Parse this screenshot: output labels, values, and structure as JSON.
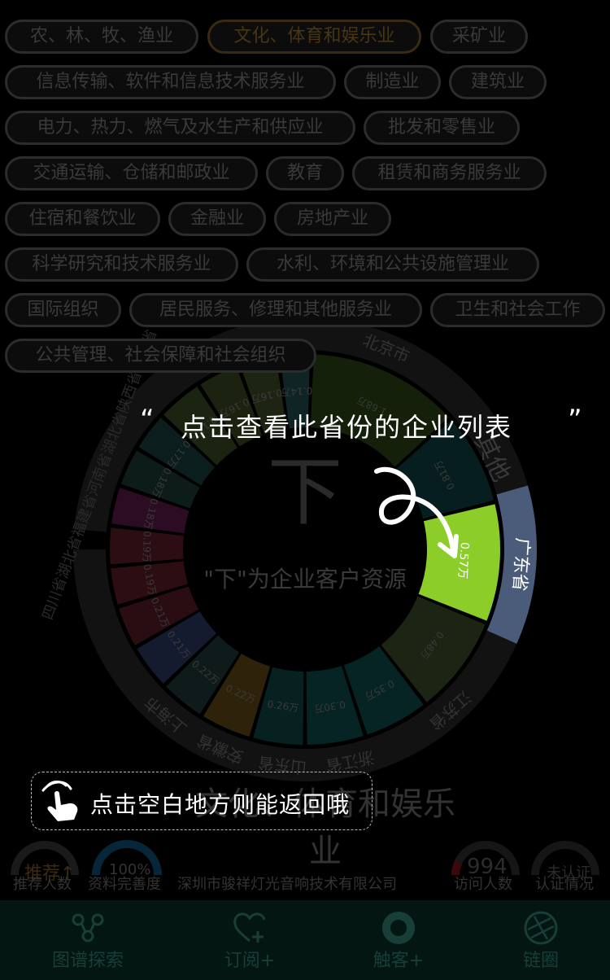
{
  "industries": [
    {
      "label": "农、林、牧、渔业"
    },
    {
      "label": "文化、体育和娱乐业",
      "active": true
    },
    {
      "label": "采矿业"
    },
    {
      "label": "信息传输、软件和信息技术服务业"
    },
    {
      "label": "制造业"
    },
    {
      "label": "建筑业"
    },
    {
      "label": "电力、热力、燃气及水生产和供应业"
    },
    {
      "label": "批发和零售业"
    },
    {
      "label": "交通运输、仓储和邮政业"
    },
    {
      "label": "教育"
    },
    {
      "label": "租赁和商务服务业"
    },
    {
      "label": "住宿和餐饮业"
    },
    {
      "label": "金融业"
    },
    {
      "label": "房地产业"
    },
    {
      "label": "科学研究和技术服务业"
    },
    {
      "label": "水利、环境和公共设施管理业"
    },
    {
      "label": "国际组织"
    },
    {
      "label": "居民服务、修理和其他服务业"
    },
    {
      "label": "卫生和社会工作"
    },
    {
      "label": "公共管理、社会保障和社会组织"
    }
  ],
  "wheel": {
    "center_char": "下",
    "center_desc": "\"下\"为企业客户资源",
    "segments": [
      {
        "value": "0.57万",
        "color": "#8ccd2a",
        "highlight": true
      },
      {
        "value": "0.48万",
        "color": "#1c2414"
      },
      {
        "value": "0.35万",
        "color": "#052423"
      },
      {
        "value": "0.30万",
        "color": "#052423"
      },
      {
        "value": "0.26万",
        "color": "#072020"
      },
      {
        "value": "0.22万",
        "color": "#2e230a"
      },
      {
        "value": "0.22万",
        "color": "#0f1a1a"
      },
      {
        "value": "0.21万",
        "color": "#141b2e"
      },
      {
        "value": "0.21万",
        "color": "#2a0d12"
      },
      {
        "value": "0.19万",
        "color": "#2c0d12"
      },
      {
        "value": "0.19万",
        "color": "#2d0d14"
      },
      {
        "value": "0.18万",
        "color": "#2c0c22"
      },
      {
        "value": "0.18万",
        "color": "#0d1c18"
      },
      {
        "value": "0.17万",
        "color": "#0b1d1d"
      },
      {
        "value": "0.17万",
        "color": "#1a2410"
      },
      {
        "value": "0.16万",
        "color": "#1c2210"
      },
      {
        "value": "0.16万",
        "color": "#1e2412"
      },
      {
        "value": "0.14万",
        "color": "#0f2424"
      },
      {
        "value": "1.68万",
        "color": "#15200b"
      },
      {
        "value": "0.81万",
        "color": "#061e20"
      }
    ],
    "outer_labels": {
      "guangdong": "广东省",
      "beijing": "北京市",
      "other": "其他",
      "jiangsu": "江苏省",
      "zhejiang": "浙江省",
      "shandong": "山东省",
      "anhui": "安徽省",
      "shanghai": "上海市",
      "left_provinces": "四川省湖北省福建省河南省湖北省陕西省河北省"
    }
  },
  "tip": {
    "quote_open": "“",
    "text": "点击查看此省份的企业列表",
    "quote_close": "”",
    "back_hint": "点击空白地方则能返回哦"
  },
  "current_industry": "文化、体育和娱乐业",
  "stats": {
    "recommend_value": "推荐↑",
    "recommend_label": "推荐人数",
    "completeness_value": "100%",
    "completeness_label": "资料完善度",
    "company_name": "深圳市骏祥灯光音响技术有限公司",
    "visitors_value": "994",
    "visitors_label": "访问人数",
    "cert_value": "未认证",
    "cert_label": "认证情况"
  },
  "tabs": [
    {
      "label": "图谱探索",
      "icon": "graph-nodes-icon"
    },
    {
      "label": "订阅+",
      "icon": "heart-plus-icon"
    },
    {
      "label": "触客+",
      "icon": "donut-icon"
    },
    {
      "label": "链圈",
      "icon": "aperture-icon"
    }
  ],
  "colors": {
    "highlight": "#8ccd2a",
    "guangdong": "#4b5c7a",
    "tabbar": "#031612",
    "tip": "#ffffff"
  }
}
